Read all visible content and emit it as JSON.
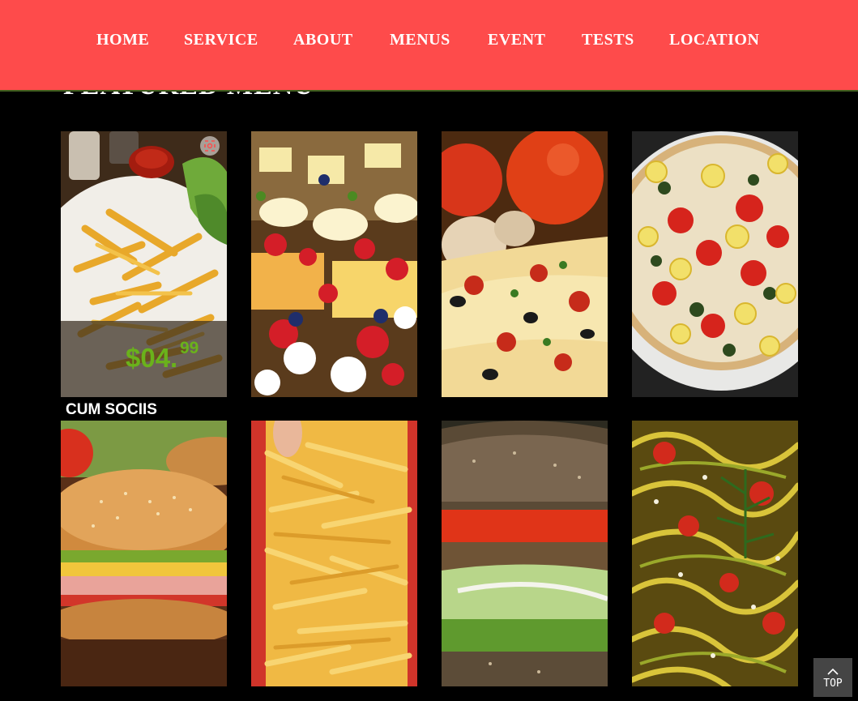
{
  "nav": {
    "items": [
      {
        "label": "HOME"
      },
      {
        "label": "SERVICE"
      },
      {
        "label": "ABOUT"
      },
      {
        "label": "MENUS"
      },
      {
        "label": "EVENT"
      },
      {
        "label": "TESTS"
      },
      {
        "label": "LOCATION"
      }
    ]
  },
  "section": {
    "title": "FEATURED MENU"
  },
  "menu_items": [
    {
      "image": "french-fries-plate-photo",
      "caption": "CUM SOCIIS",
      "price_main": "$04.",
      "price_cents": "99"
    },
    {
      "image": "pastry-desserts-photo"
    },
    {
      "image": "pizza-slice-tomatoes-photo"
    },
    {
      "image": "vegetable-pizza-photo"
    },
    {
      "image": "sub-sandwich-photo"
    },
    {
      "image": "french-fries-pile-photo"
    },
    {
      "image": "rye-burger-photo"
    },
    {
      "image": "vegetable-noodles-photo"
    }
  ],
  "back_to_top": {
    "label": "TOP"
  },
  "colors": {
    "nav_bg": "#fe4b4b",
    "price": "#6ab21b",
    "page_bg": "#000000"
  }
}
